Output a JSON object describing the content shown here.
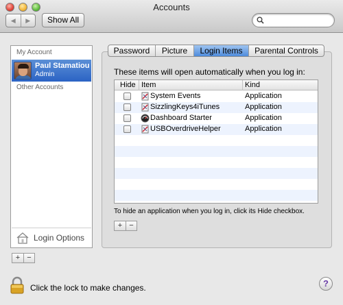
{
  "window": {
    "title": "Accounts"
  },
  "toolbar": {
    "back_glyph": "◀",
    "forward_glyph": "▶",
    "show_all_label": "Show All",
    "search": {
      "placeholder": "",
      "value": ""
    }
  },
  "accounts": {
    "my_account_header": "My Account",
    "selected": {
      "name": "Paul Stamatiou",
      "role": "Admin"
    },
    "other_accounts_header": "Other Accounts",
    "login_options_label": "Login Options",
    "add_label": "+",
    "remove_label": "−"
  },
  "tabs": [
    {
      "label": "Password",
      "active": false
    },
    {
      "label": "Picture",
      "active": false
    },
    {
      "label": "Login Items",
      "active": true
    },
    {
      "label": "Parental Controls",
      "active": false
    }
  ],
  "login_items": {
    "intro": "These items will open automatically when you log in:",
    "columns": {
      "hide": "Hide",
      "item": "Item",
      "kind": "Kind"
    },
    "rows": [
      {
        "name": "System Events",
        "kind": "Application",
        "hidden": false,
        "icon": "app-icon"
      },
      {
        "name": "SizzlingKeys4iTunes",
        "kind": "Application",
        "hidden": false,
        "icon": "app-icon"
      },
      {
        "name": "Dashboard Starter",
        "kind": "Application",
        "hidden": false,
        "icon": "dashboard-icon"
      },
      {
        "name": "USBOverdriveHelper",
        "kind": "Application",
        "hidden": false,
        "icon": "app-icon"
      }
    ],
    "hint": "To hide an application when you log in, click its Hide checkbox.",
    "add_label": "+",
    "remove_label": "−"
  },
  "footer": {
    "lock_text": "Click the lock to make changes.",
    "help_label": "?"
  },
  "colors": {
    "selection": "#2b63c4",
    "active_tab": "#4e8bdc",
    "alt_row": "#edf3fe"
  }
}
